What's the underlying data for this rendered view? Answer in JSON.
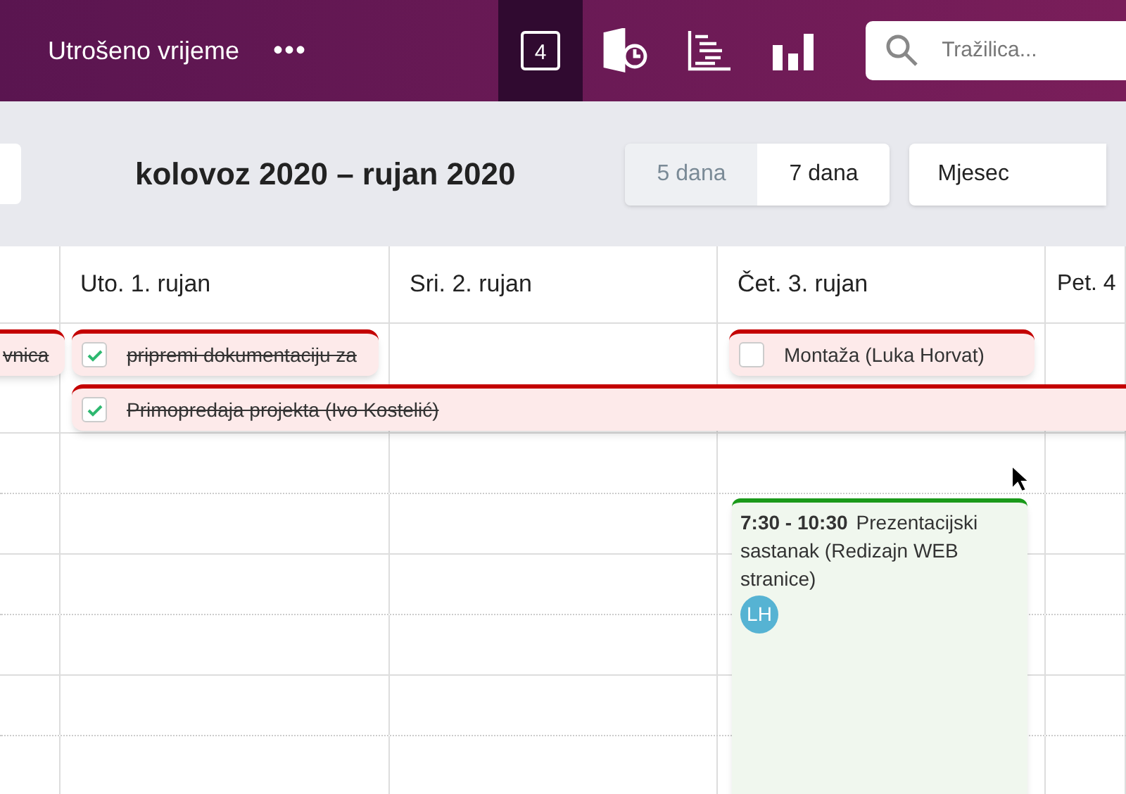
{
  "header": {
    "title": "Utrošeno vrijeme",
    "more": "•••",
    "nav": [
      {
        "kind": "calendar",
        "badge": "4",
        "selected": true
      },
      {
        "kind": "timesheet",
        "selected": false
      },
      {
        "kind": "gantt",
        "selected": false
      },
      {
        "kind": "chart",
        "selected": false
      }
    ],
    "search": {
      "placeholder": "Tražilica..."
    }
  },
  "toolbar": {
    "range": "kolovoz 2020 – rujan 2020",
    "views": [
      {
        "label": "5 dana",
        "selected": false
      },
      {
        "label": "7 dana",
        "selected": true
      }
    ],
    "month": "Mjesec"
  },
  "days": [
    "Uto. 1. rujan",
    "Sri. 2. rujan",
    "Čet. 3. rujan",
    "Pet. 4"
  ],
  "all_day": [
    {
      "title": "vnica",
      "done": true
    },
    {
      "title": "pripremi dokumentaciju za",
      "checked": true
    },
    {
      "title": "Montaža (Luka Horvat)",
      "checked": false
    },
    {
      "title": "Primopredaja projekta (Ivo Kostelić)",
      "checked": true
    }
  ],
  "event": {
    "time": "7:30 - 10:30",
    "title": "Prezentacijski sastanak (Redizajn WEB stranice)",
    "avatar": "LH"
  }
}
